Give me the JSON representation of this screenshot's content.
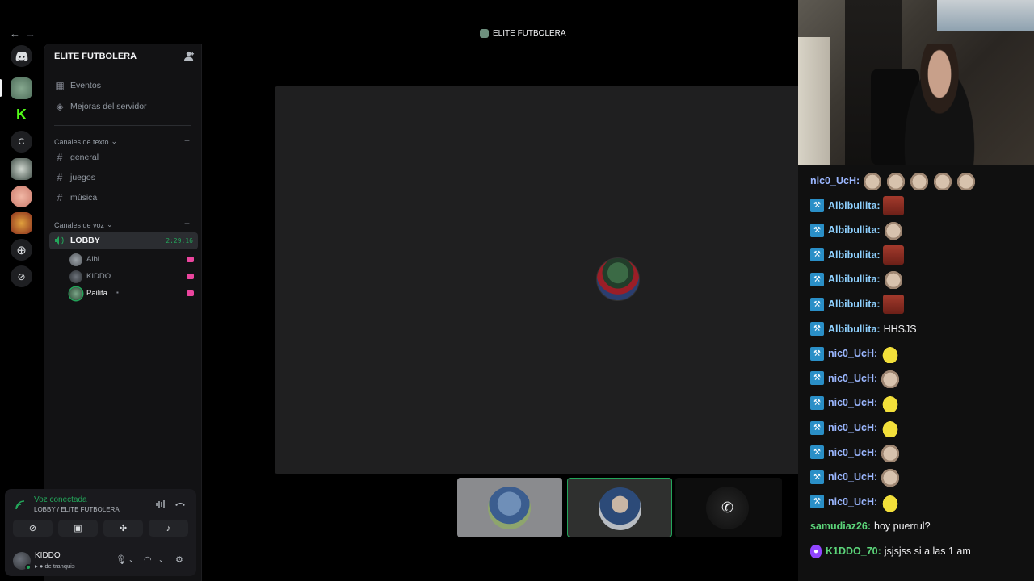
{
  "window": {
    "title": "ELITE FUTBOLERA"
  },
  "rail": {
    "dm_label": "C"
  },
  "server": {
    "name": "ELITE FUTBOLERA"
  },
  "sidebar": {
    "top_items": [
      {
        "label": "Eventos",
        "icon": "calendar-icon"
      },
      {
        "label": "Mejoras del servidor",
        "icon": "boost-icon"
      }
    ],
    "text_category": "Canales de texto",
    "text_channels": [
      "general",
      "juegos",
      "música"
    ],
    "voice_category": "Canales de voz",
    "voice_channel": {
      "name": "LOBBY",
      "timer": "2:29:16"
    },
    "members": [
      {
        "name": "Albi"
      },
      {
        "name": "KIDDO"
      },
      {
        "name": "Pailita"
      }
    ]
  },
  "voice": {
    "status": "Voz conectada",
    "channel": "LOBBY / ELITE FUTBOLERA"
  },
  "user": {
    "name": "KIDDO",
    "status": "de tranquis"
  },
  "chat": {
    "messages": [
      {
        "user": "nic0_UcH",
        "text": "",
        "color": "#9bb7ff",
        "emotes": [
          "cat",
          "cat",
          "cat",
          "cat",
          "cat"
        ],
        "badge": false
      },
      {
        "user": "Albibullita",
        "text": "",
        "color": "#8fd1ff",
        "emotes": [
          "red"
        ],
        "badge": true
      },
      {
        "user": "Albibullita",
        "text": "",
        "color": "#8fd1ff",
        "emotes": [
          "cat"
        ],
        "badge": true
      },
      {
        "user": "Albibullita",
        "text": "",
        "color": "#8fd1ff",
        "emotes": [
          "red"
        ],
        "badge": true
      },
      {
        "user": "Albibullita",
        "text": "",
        "color": "#8fd1ff",
        "emotes": [
          "cat"
        ],
        "badge": true
      },
      {
        "user": "Albibullita",
        "text": "",
        "color": "#8fd1ff",
        "emotes": [
          "red"
        ],
        "badge": true
      },
      {
        "user": "Albibullita",
        "text": "HHSJS",
        "color": "#8fd1ff",
        "emotes": [],
        "badge": true
      },
      {
        "user": "nic0_UcH",
        "text": "",
        "color": "#9bb7ff",
        "emotes": [
          "yel"
        ],
        "badge": true
      },
      {
        "user": "nic0_UcH",
        "text": "",
        "color": "#9bb7ff",
        "emotes": [
          "cat"
        ],
        "badge": true
      },
      {
        "user": "nic0_UcH",
        "text": "",
        "color": "#9bb7ff",
        "emotes": [
          "yel"
        ],
        "badge": true
      },
      {
        "user": "nic0_UcH",
        "text": "",
        "color": "#9bb7ff",
        "emotes": [
          "yel"
        ],
        "badge": true
      },
      {
        "user": "nic0_UcH",
        "text": "",
        "color": "#9bb7ff",
        "emotes": [
          "cat"
        ],
        "badge": true
      },
      {
        "user": "nic0_UcH",
        "text": "",
        "color": "#9bb7ff",
        "emotes": [
          "cat"
        ],
        "badge": true
      },
      {
        "user": "nic0_UcH",
        "text": "",
        "color": "#9bb7ff",
        "emotes": [
          "yel"
        ],
        "badge": true
      },
      {
        "user": "samudiaz26",
        "text": "hoy puerrul?",
        "color": "#5cd67a",
        "emotes": [],
        "badge": false
      },
      {
        "user": "K1DDO_70",
        "text": "jsjsjss si a las 1 am",
        "color": "#5cd67a",
        "emotes": [],
        "badge": "mic"
      }
    ]
  },
  "colors": {
    "accent_green": "#23a55a",
    "twitch_blue": "#2a8fc7"
  }
}
